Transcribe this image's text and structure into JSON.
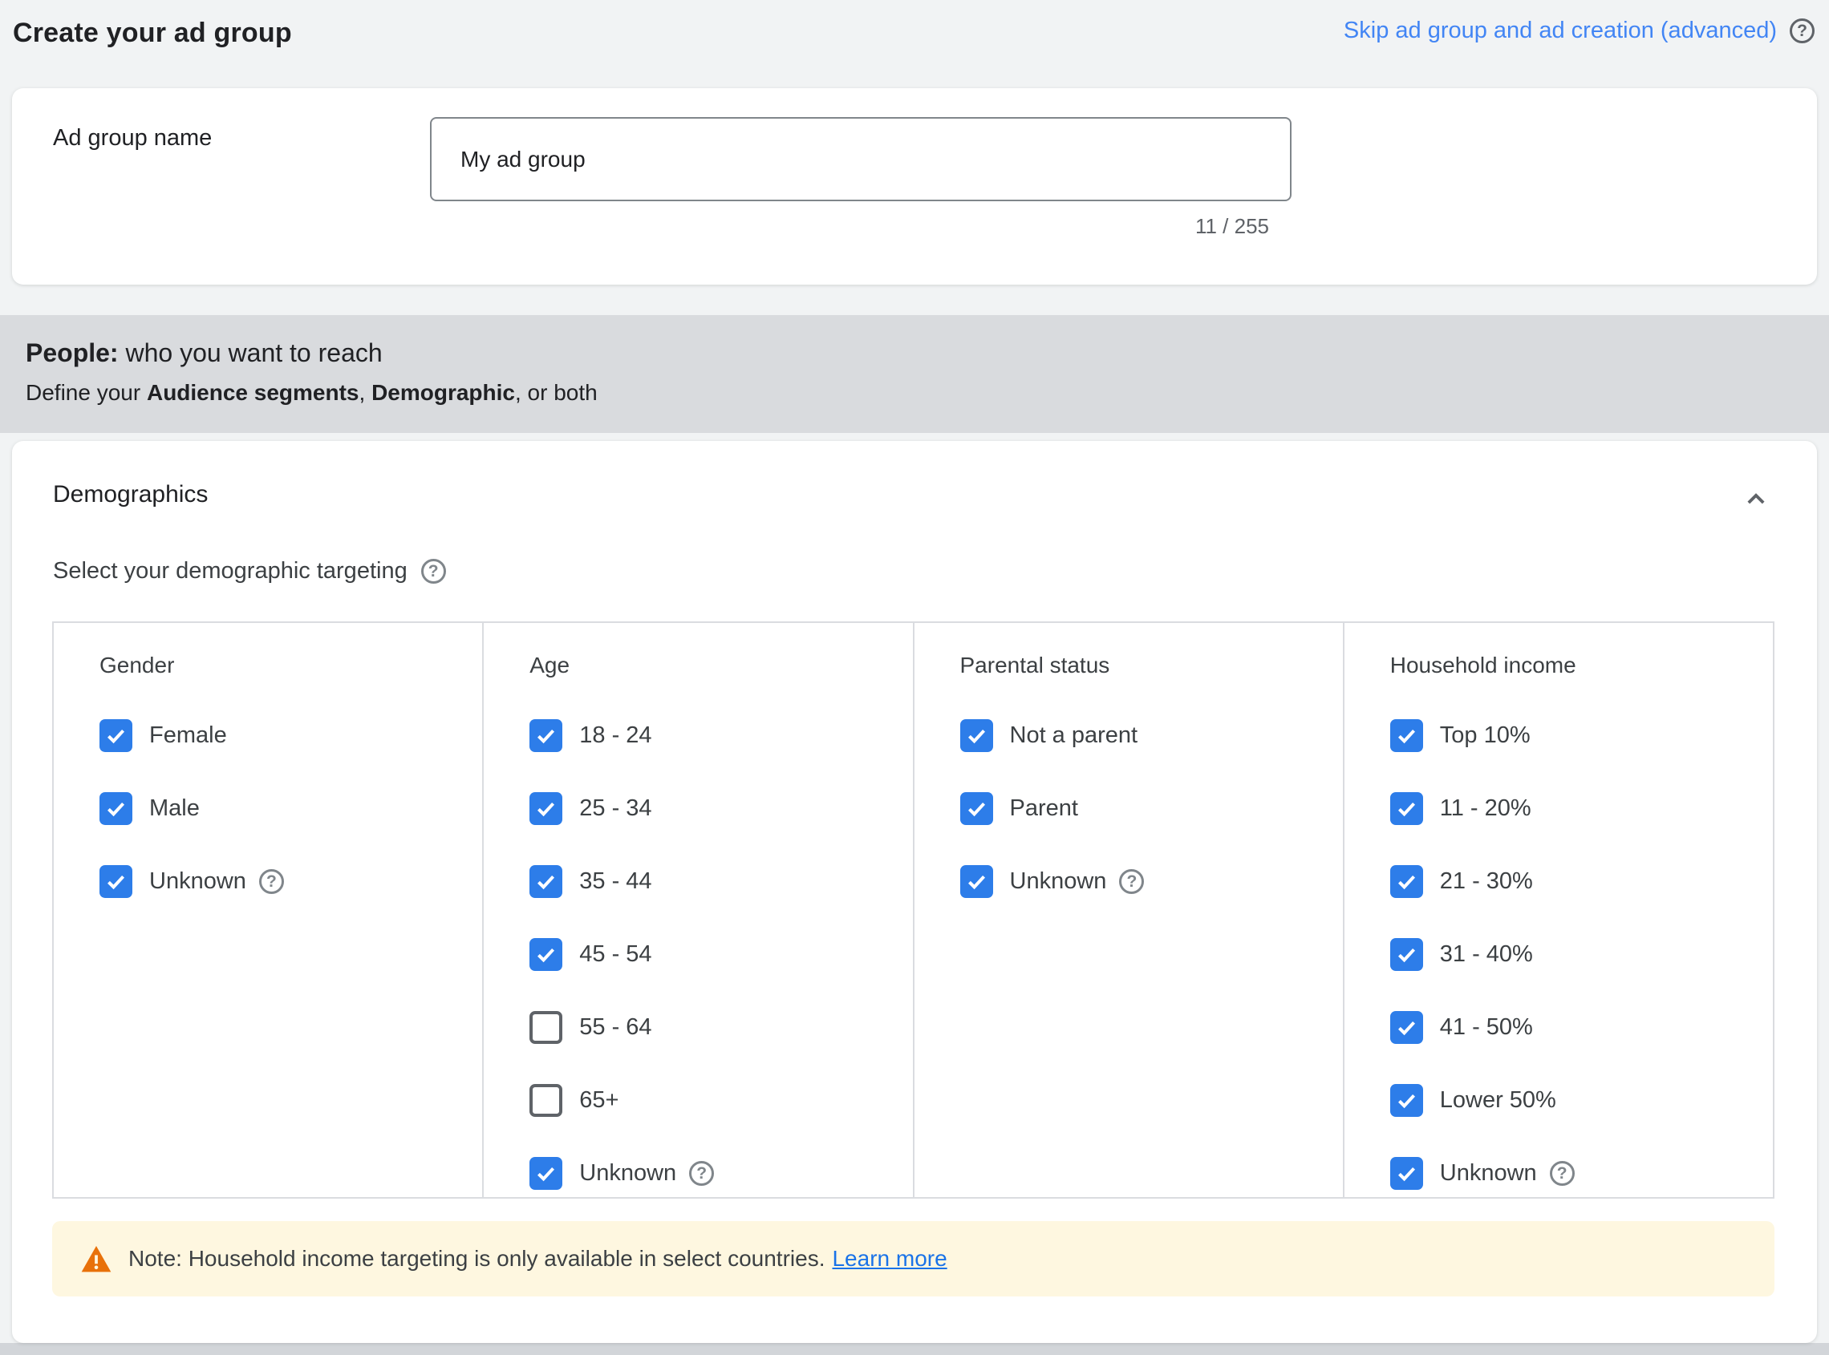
{
  "page": {
    "title": "Create your ad group",
    "skip_link": "Skip ad group and ad creation (advanced)"
  },
  "ad_group_card": {
    "label": "Ad group name",
    "input_value": "My ad group",
    "char_counter": "11 / 255"
  },
  "people_section": {
    "heading_bold": "People:",
    "heading_rest": " who you want to reach",
    "subtitle_prefix": "Define your ",
    "subtitle_bold1": "Audience segments",
    "subtitle_sep": ", ",
    "subtitle_bold2": "Demographic",
    "subtitle_suffix": ", or both"
  },
  "demographics": {
    "title": "Demographics",
    "subtitle": "Select your demographic targeting",
    "columns": [
      {
        "header": "Gender",
        "options": [
          {
            "label": "Female",
            "checked": true
          },
          {
            "label": "Male",
            "checked": true
          },
          {
            "label": "Unknown",
            "checked": true,
            "help": true
          }
        ]
      },
      {
        "header": "Age",
        "options": [
          {
            "label": "18 - 24",
            "checked": true
          },
          {
            "label": "25 - 34",
            "checked": true
          },
          {
            "label": "35 - 44",
            "checked": true
          },
          {
            "label": "45 - 54",
            "checked": true
          },
          {
            "label": "55 - 64",
            "checked": false
          },
          {
            "label": "65+",
            "checked": false
          },
          {
            "label": "Unknown",
            "checked": true,
            "help": true
          }
        ]
      },
      {
        "header": "Parental status",
        "options": [
          {
            "label": "Not a parent",
            "checked": true
          },
          {
            "label": "Parent",
            "checked": true
          },
          {
            "label": "Unknown",
            "checked": true,
            "help": true
          }
        ]
      },
      {
        "header": "Household income",
        "options": [
          {
            "label": "Top 10%",
            "checked": true
          },
          {
            "label": "11 - 20%",
            "checked": true
          },
          {
            "label": "21 - 30%",
            "checked": true
          },
          {
            "label": "31 - 40%",
            "checked": true
          },
          {
            "label": "41 - 50%",
            "checked": true
          },
          {
            "label": "Lower 50%",
            "checked": true
          },
          {
            "label": "Unknown",
            "checked": true,
            "help": true
          }
        ]
      }
    ]
  },
  "note": {
    "text": "Note: Household income targeting is only available in select countries.",
    "link": "Learn more"
  },
  "colors": {
    "accent_blue": "#2d7de9",
    "link_blue": "#4285f4",
    "learn_more_blue": "#1a73e8",
    "warning_orange": "#e8710a",
    "note_background": "#fef7e0",
    "band_gray": "#d9dbde"
  }
}
